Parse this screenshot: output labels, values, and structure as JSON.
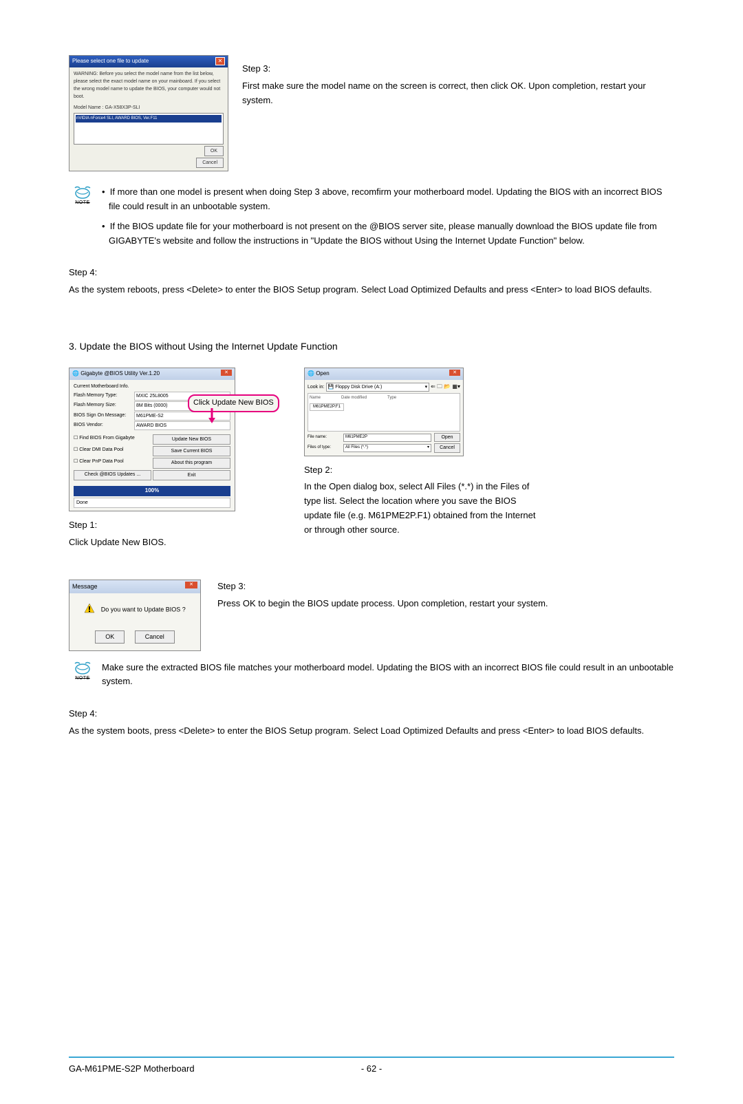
{
  "dialog1": {
    "title": "Please select one file to update",
    "warning": "WARNING: Before you select the model name from the list below, please select the exact model name on your mainboard. If you select the wrong model name to update the BIOS, your computer would not boot.",
    "model_label": "Model Name : GA-X58X3P-SLI",
    "list_item": "nVIDIA nForce4 SLI, AWARD BIOS, Ver.F11",
    "ok": "OK",
    "cancel": "Cancel"
  },
  "step3a": {
    "heading": "Step 3:",
    "text": "First make sure the model name on the screen is correct, then click OK. Upon completion, restart your system."
  },
  "note1": {
    "label": "NOTE",
    "b1": "If more than one model is present when doing Step 3 above, recomfirm your motherboard model. Updating the BIOS with an incorrect BIOS file could result in an unbootable system.",
    "b2": "If the BIOS update file for your motherboard is not present on the @BIOS server site, please manually download the BIOS update file from GIGABYTE's website and follow the instructions in \"Update the BIOS without Using the Internet Update Function\" below."
  },
  "step4a": {
    "heading": "Step 4:",
    "text": "As the system reboots, press <Delete> to enter the BIOS Setup program. Select Load Optimized Defaults and press <Enter> to load BIOS defaults."
  },
  "section3": {
    "heading": "3.   Update the BIOS without Using the Internet Update Function"
  },
  "bios_util": {
    "title": "Gigabyte @BIOS Utility Ver.1.20",
    "group": "Current Motherboard Info.",
    "flash_type_lbl": "Flash Memory Type:",
    "flash_type_val": "MXIC 25L8005",
    "flash_size_lbl": "Flash Memory Size:",
    "flash_size_val": "8M Bits (0000)",
    "sign_lbl": "BIOS Sign On Message:",
    "sign_val": "M61PME-S2",
    "vendor_lbl": "BIOS Vendor:",
    "vendor_val": "AWARD BIOS",
    "opt_find": "Find BIOS From Gigabyte",
    "opt_dmi": "Clear DMI Data Pool",
    "opt_pnp": "Clear PnP Data Pool",
    "opt_check": "Check @BIOS Updates ...",
    "btn_update": "Update New BIOS",
    "btn_save": "Save Current BIOS",
    "btn_about": "About this program",
    "btn_exit": "Exit",
    "progress": "100%",
    "status": "Done"
  },
  "callout": "Click Update New BIOS",
  "step1": {
    "heading": "Step 1:",
    "text": "Click Update New BIOS."
  },
  "open_dialog": {
    "title": "Open",
    "lookin_lbl": "Look in:",
    "lookin_val": "Floppy Disk Drive (A:)",
    "col_name": "Name",
    "col_date": "Date modified",
    "col_type": "Type",
    "file_item": "M61PME2P.F1",
    "filename_lbl": "File name:",
    "filename_val": "M61PME2P",
    "filetype_lbl": "Files of type:",
    "filetype_val": "All Files (*.*)",
    "open_btn": "Open",
    "cancel_btn": "Cancel"
  },
  "step2": {
    "heading": "Step 2:",
    "text": "In the Open dialog box, select  All Files (*.*) in the Files of type list. Select the location where you save the BIOS update file (e.g. M61PME2P.F1) obtained from the Internet or through other source."
  },
  "msg_dialog": {
    "title": "Message",
    "text": "Do you want to Update BIOS ?",
    "ok": "OK",
    "cancel": "Cancel"
  },
  "step3b": {
    "heading": "Step 3:",
    "text": "Press OK to begin the BIOS update process. Upon completion, restart your system."
  },
  "note2": {
    "label": "NOTE",
    "text": "Make sure the extracted BIOS file matches your motherboard model. Updating the BIOS with an incorrect BIOS file could result in an unbootable system."
  },
  "step4b": {
    "heading": "Step 4:",
    "text": "As the system boots, press <Delete> to enter the BIOS Setup program. Select Load Optimized Defaults and press <Enter> to load BIOS defaults."
  },
  "footer": {
    "left": "GA-M61PME-S2P Motherboard",
    "center": "- 62 -"
  }
}
